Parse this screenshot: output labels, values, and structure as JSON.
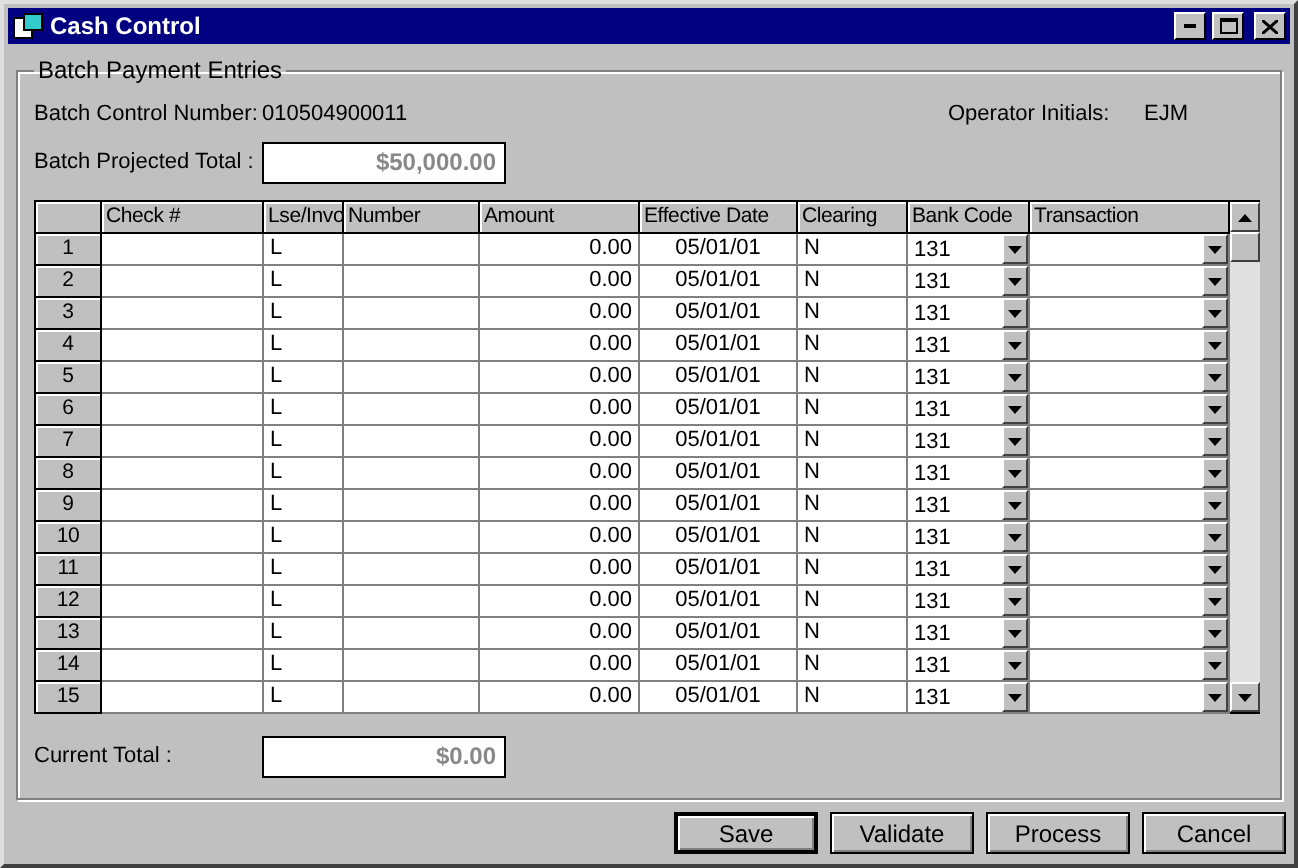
{
  "window": {
    "title": "Cash Control"
  },
  "group": {
    "title": "Batch Payment Entries"
  },
  "batch_control": {
    "label": "Batch Control Number:",
    "value": "010504900011"
  },
  "operator": {
    "label": "Operator Initials:",
    "value": "EJM"
  },
  "projected_total": {
    "label": "Batch Projected Total :",
    "value": "$50,000.00",
    "disabled": true
  },
  "table": {
    "columns": [
      "Check #",
      "Lse/Invo",
      "Number",
      "Amount",
      "Effective Date",
      "Clearing",
      "Bank Code",
      "Transaction"
    ],
    "rows": [
      {
        "row": "1",
        "lse": "L",
        "amount": "0.00",
        "date": "05/01/01",
        "clearing": "N",
        "bank": "131"
      },
      {
        "row": "2",
        "lse": "L",
        "amount": "0.00",
        "date": "05/01/01",
        "clearing": "N",
        "bank": "131"
      },
      {
        "row": "3",
        "lse": "L",
        "amount": "0.00",
        "date": "05/01/01",
        "clearing": "N",
        "bank": "131"
      },
      {
        "row": "4",
        "lse": "L",
        "amount": "0.00",
        "date": "05/01/01",
        "clearing": "N",
        "bank": "131"
      },
      {
        "row": "5",
        "lse": "L",
        "amount": "0.00",
        "date": "05/01/01",
        "clearing": "N",
        "bank": "131"
      },
      {
        "row": "6",
        "lse": "L",
        "amount": "0.00",
        "date": "05/01/01",
        "clearing": "N",
        "bank": "131"
      },
      {
        "row": "7",
        "lse": "L",
        "amount": "0.00",
        "date": "05/01/01",
        "clearing": "N",
        "bank": "131"
      },
      {
        "row": "8",
        "lse": "L",
        "amount": "0.00",
        "date": "05/01/01",
        "clearing": "N",
        "bank": "131"
      },
      {
        "row": "9",
        "lse": "L",
        "amount": "0.00",
        "date": "05/01/01",
        "clearing": "N",
        "bank": "131"
      },
      {
        "row": "10",
        "lse": "L",
        "amount": "0.00",
        "date": "05/01/01",
        "clearing": "N",
        "bank": "131"
      },
      {
        "row": "11",
        "lse": "L",
        "amount": "0.00",
        "date": "05/01/01",
        "clearing": "N",
        "bank": "131"
      },
      {
        "row": "12",
        "lse": "L",
        "amount": "0.00",
        "date": "05/01/01",
        "clearing": "N",
        "bank": "131"
      },
      {
        "row": "13",
        "lse": "L",
        "amount": "0.00",
        "date": "05/01/01",
        "clearing": "N",
        "bank": "131"
      },
      {
        "row": "14",
        "lse": "L",
        "amount": "0.00",
        "date": "05/01/01",
        "clearing": "N",
        "bank": "131"
      },
      {
        "row": "15",
        "lse": "L",
        "amount": "0.00",
        "date": "05/01/01",
        "clearing": "N",
        "bank": "131"
      }
    ]
  },
  "current_total": {
    "label": "Current Total :",
    "value": "$0.00",
    "disabled": true
  },
  "buttons": [
    {
      "label": "Save",
      "default": true
    },
    {
      "label": "Validate",
      "default": false
    },
    {
      "label": "Process",
      "default": false
    },
    {
      "label": "Cancel",
      "default": false
    }
  ]
}
